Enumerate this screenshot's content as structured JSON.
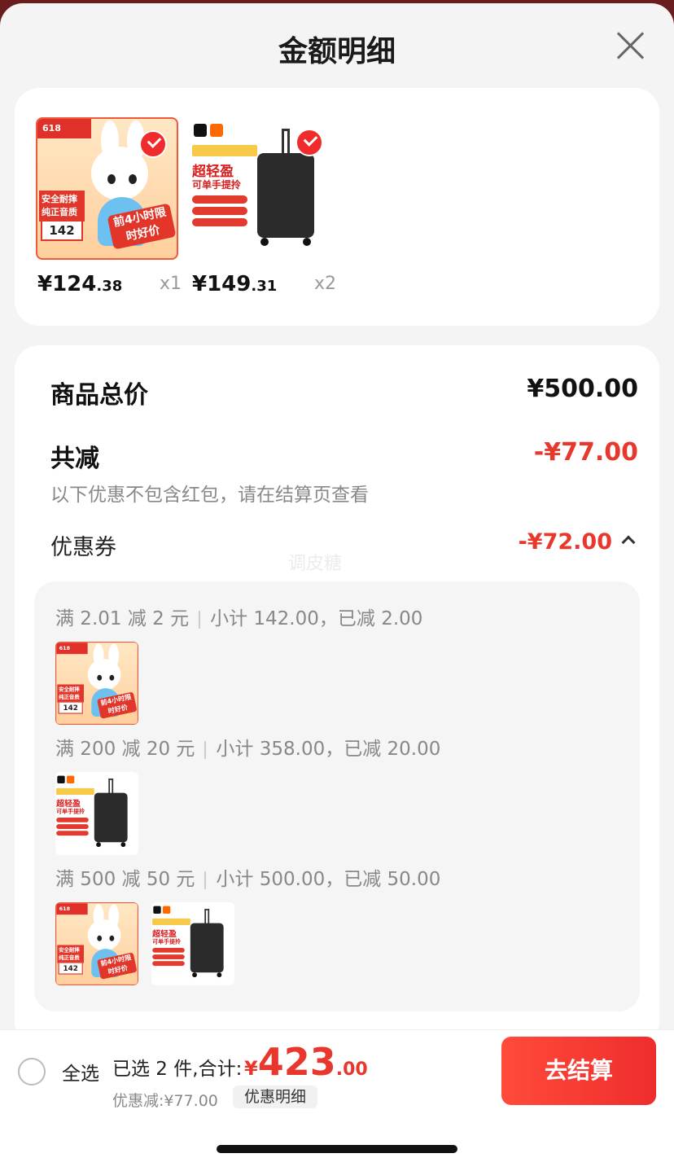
{
  "header": {
    "title": "金额明细"
  },
  "products": [
    {
      "price_int": "¥124",
      "price_dec": ".38",
      "qty": "x1",
      "badge": "618",
      "left_text": "安全耐摔纯正音质",
      "thumb_price": "142",
      "tag": "前4小时限时好价"
    },
    {
      "price_int": "¥149",
      "price_dec": ".31",
      "qty": "x2",
      "title": "超轻盈",
      "sub": "可单手提拎"
    }
  ],
  "summary": {
    "total_label": "商品总价",
    "total_value": "¥500.00",
    "discount_label": "共减",
    "discount_value": "-¥77.00",
    "note": "以下优惠不包含红包，请在结算页查看",
    "coupon_label": "优惠券",
    "coupon_value": "-¥72.00",
    "watermark": "调皮糖"
  },
  "coupons": [
    {
      "rule": "满 2.01 减 2 元",
      "detail": "小计 142.00，已减 2.00"
    },
    {
      "rule": "满 200 减 20 元",
      "detail": "小计 358.00，已减 20.00"
    },
    {
      "rule": "满 500 减 50 元",
      "detail": "小计 500.00，已减 50.00"
    }
  ],
  "footer": {
    "select_all": "全选",
    "selected": "已选 2 件,合计:",
    "currency": "¥",
    "total_int": "423",
    "total_dec": ".00",
    "saved": "优惠减:¥77.00",
    "detail_button": "优惠明细",
    "checkout": "去结算"
  },
  "colors": {
    "accent": "#e8382d",
    "sheet_bg": "#f4f4f4",
    "backdrop": "#6b1d1d"
  }
}
